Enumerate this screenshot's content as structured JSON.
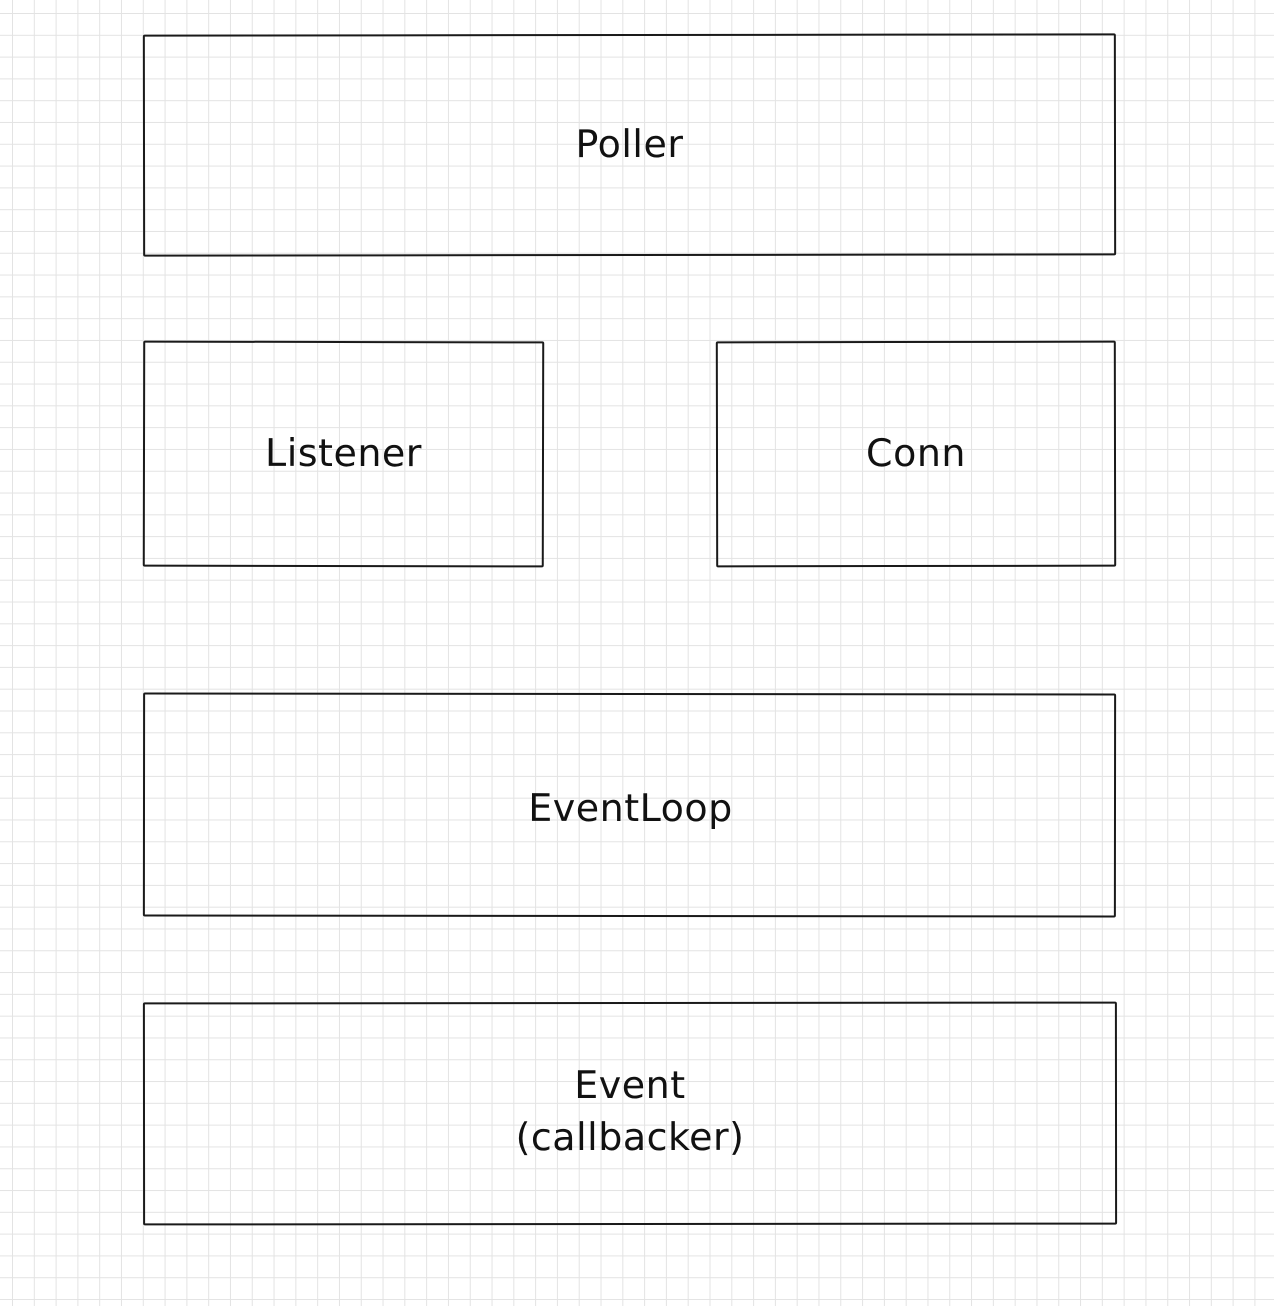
{
  "diagram": {
    "blocks": [
      {
        "id": "poller",
        "label": "Poller"
      },
      {
        "id": "listener",
        "label": "Listener"
      },
      {
        "id": "conn",
        "label": "Conn"
      },
      {
        "id": "eventloop",
        "label": "EventLoop"
      },
      {
        "id": "event",
        "label_lines": [
          "Event",
          "(callbacker)"
        ]
      }
    ]
  },
  "colors": {
    "stroke": "#1a1a1a",
    "text": "#111111",
    "grid": "#e3e3e3",
    "background": "#ffffff"
  }
}
